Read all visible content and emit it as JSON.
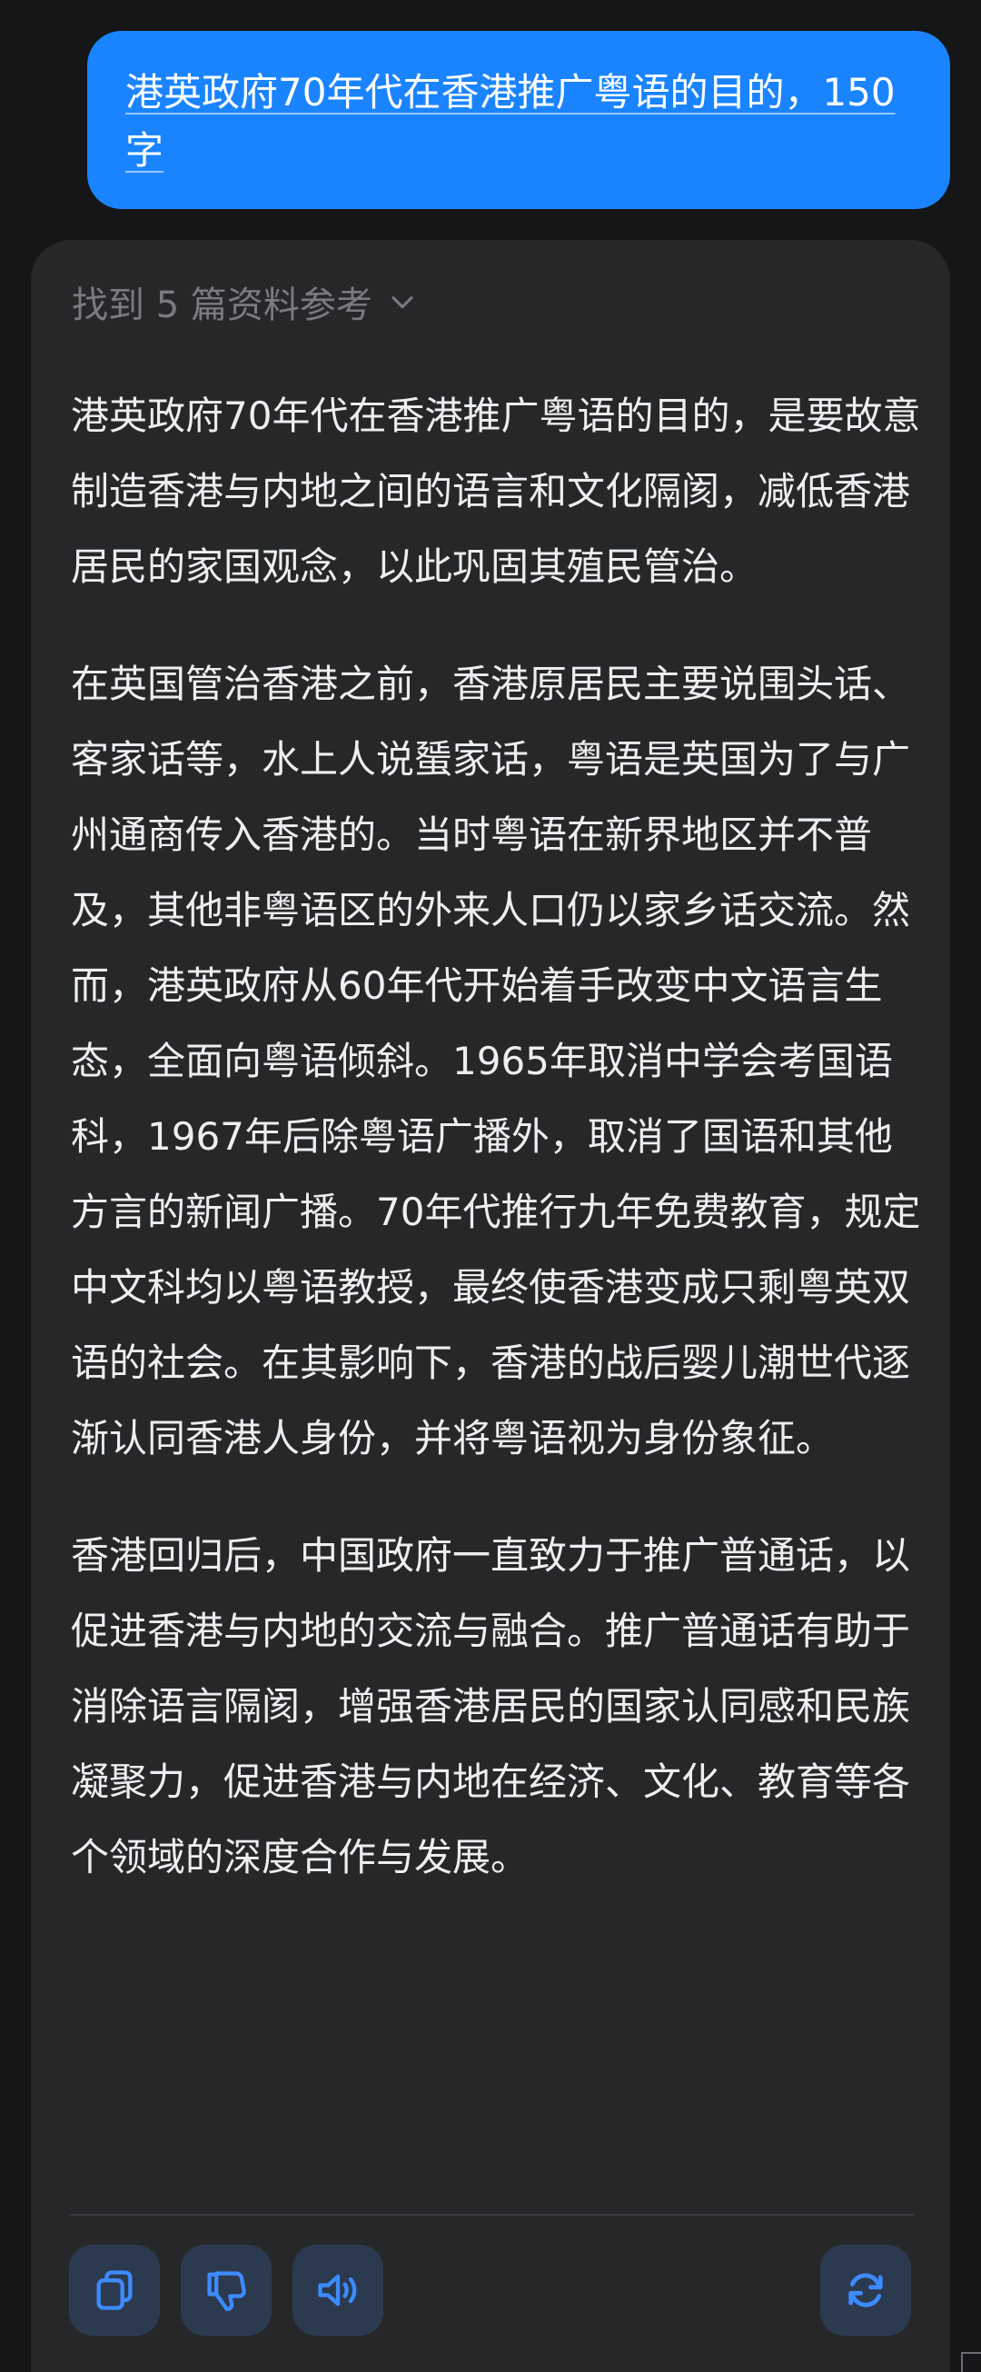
{
  "user_message": {
    "text": "港英政府70年代在香港推广粤语的目的，150字"
  },
  "answer": {
    "sources_label": "找到 5 篇资料参考",
    "paragraphs": [
      "港英政府70年代在香港推广粤语的目的，是要故意制造香港与内地之间的语言和文化隔阂，减低香港居民的家国观念，以此巩固其殖民管治。",
      "在英国管治香港之前，香港原居民主要说围头话、客家话等，水上人说蜑家话，粤语是英国为了与广州通商传入香港的。当时粤语在新界地区并不普及，其他非粤语区的外来人口仍以家乡话交流。然而，港英政府从60年代开始着手改变中文语言生态，全面向粤语倾斜。1965年取消中学会考国语科，1967年后除粤语广播外，取消了国语和其他方言的新闻广播。70年代推行九年免费教育，规定中文科均以粤语教授，最终使香港变成只剩粤英双语的社会。在其影响下，香港的战后婴儿潮世代逐渐认同香港人身份，并将粤语视为身份象征。",
      "香港回归后，中国政府一直致力于推广普通话，以促进香港与内地的交流与融合。推广普通话有助于消除语言隔阂，增强香港居民的国家认同感和民族凝聚力，促进香港与内地在经济、文化、教育等各个领域的深度合作与发展。"
    ]
  },
  "actions": {
    "copy_icon": "copy-icon",
    "dislike_icon": "thumbs-down-icon",
    "speak_icon": "speaker-icon",
    "regenerate_icon": "refresh-icon",
    "icon_color": "#3d8bff"
  },
  "colors": {
    "background": "#151618",
    "user_bubble": "#1a84ff",
    "card": "#262729",
    "text": "#eceef0",
    "muted": "#7a7b7e"
  }
}
